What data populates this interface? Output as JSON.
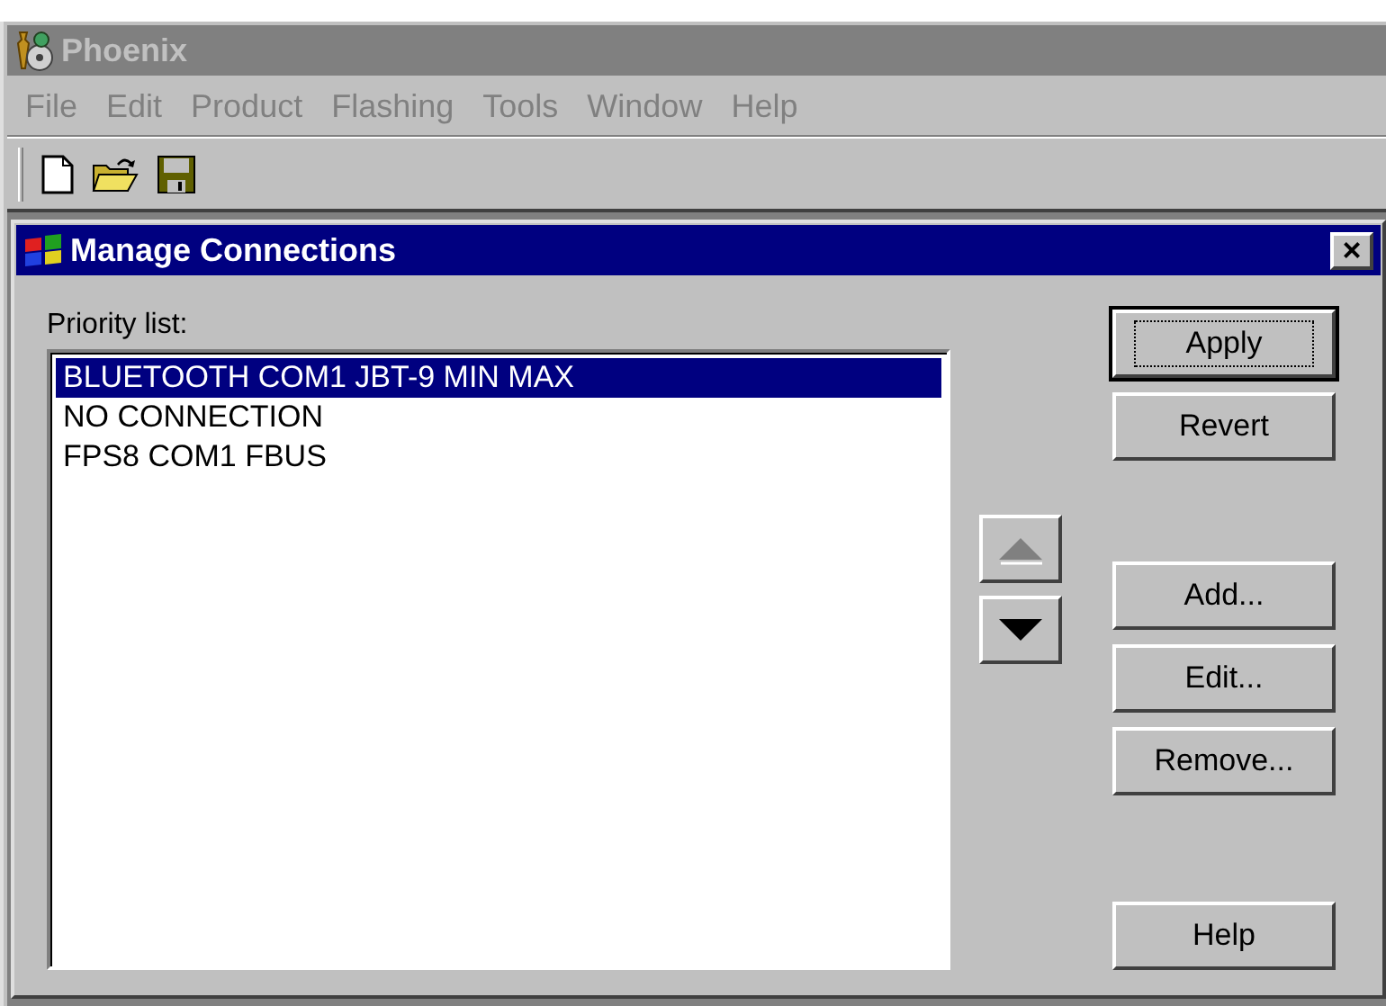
{
  "window": {
    "title": "Phoenix",
    "active": false
  },
  "menu": [
    {
      "label": "File",
      "disabled": true
    },
    {
      "label": "Edit",
      "disabled": true
    },
    {
      "label": "Product",
      "disabled": true
    },
    {
      "label": "Flashing",
      "disabled": true
    },
    {
      "label": "Tools",
      "disabled": true
    },
    {
      "label": "Window",
      "disabled": true
    },
    {
      "label": "Help",
      "disabled": true
    }
  ],
  "dialog": {
    "title": "Manage Connections",
    "close": "×",
    "list_label": "Priority list:",
    "items": [
      {
        "label": "BLUETOOTH COM1 JBT-9 MIN MAX",
        "selected": true
      },
      {
        "label": "NO CONNECTION",
        "selected": false
      },
      {
        "label": "FPS8 COM1 FBUS",
        "selected": false
      }
    ],
    "move_buttons": [
      {
        "kind": "up",
        "disabled": true
      },
      {
        "kind": "down",
        "disabled": false
      }
    ],
    "button_groups": [
      [
        {
          "label": "Apply",
          "default": true
        },
        {
          "label": "Revert",
          "default": false
        }
      ],
      [
        {
          "label": "Add...",
          "default": false
        },
        {
          "label": "Edit...",
          "default": false
        },
        {
          "label": "Remove...",
          "default": false
        }
      ],
      [
        {
          "label": "Help",
          "default": false
        }
      ]
    ]
  }
}
